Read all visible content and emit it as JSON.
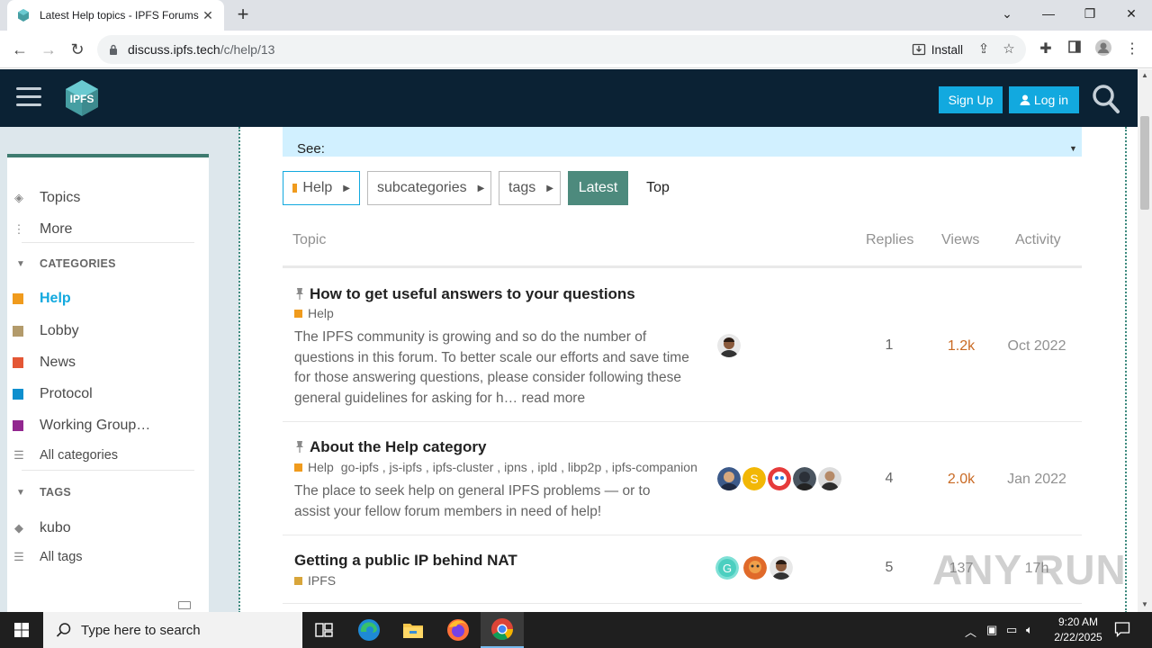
{
  "browser": {
    "tab_title": "Latest Help topics - IPFS Forums",
    "tab_close": "✕",
    "new_tab": "+",
    "url_host": "discuss.ipfs.tech",
    "url_path": "/c/help/13",
    "install_label": "Install",
    "controls": {
      "back": "←",
      "forward": "→",
      "reload": "↻"
    }
  },
  "window": {
    "minimize": "—",
    "maximize": "❐",
    "close": "✕",
    "tab_list": "⌄"
  },
  "header": {
    "logo_text": "IPFS",
    "signup_label": "Sign Up",
    "login_label": "Log in"
  },
  "sidebar": {
    "top_items": [
      {
        "label": "Topics",
        "icon": "layers-icon"
      },
      {
        "label": "More",
        "icon": "kebab-icon"
      }
    ],
    "categories_heading": "CATEGORIES",
    "categories": [
      {
        "label": "Help",
        "color": "#f09b1d",
        "active": true
      },
      {
        "label": "Lobby",
        "color": "#b39b6b"
      },
      {
        "label": "News",
        "color": "#e45735"
      },
      {
        "label": "Protocol",
        "color": "#0e8fce"
      },
      {
        "label": "Working Group…",
        "color": "#92278f"
      }
    ],
    "all_categories": "All categories",
    "tags_heading": "TAGS",
    "tags": [
      {
        "label": "kubo"
      }
    ],
    "all_tags": "All tags"
  },
  "banner": {
    "text": "See:"
  },
  "filters": {
    "category": "Help",
    "subcategories": "subcategories",
    "tags": "tags",
    "latest": "Latest",
    "top": "Top"
  },
  "table": {
    "headers": {
      "topic": "Topic",
      "replies": "Replies",
      "views": "Views",
      "activity": "Activity"
    },
    "rows": [
      {
        "title": "How to get useful answers to your questions",
        "pinned": true,
        "category": "Help",
        "category_color": "#f09b1d",
        "tags": "",
        "excerpt_lines": [
          "The IPFS community is growing and so do the number of",
          "questions in this forum. To better scale our efforts and save time",
          "for those answering questions, please consider following these",
          "general guidelines for asking for h… read more"
        ],
        "replies": "1",
        "views": "1.2k",
        "activity": "Oct 2022"
      },
      {
        "title": "About the Help category",
        "pinned": true,
        "category": "Help",
        "category_color": "#f09b1d",
        "tags": "go-ipfs , js-ipfs , ipfs-cluster , ipns , ipld , libp2p , ipfs-companion",
        "excerpt_lines": [
          "The place to seek help on general IPFS problems — or to",
          "assist your fellow forum members in need of help!"
        ],
        "replies": "4",
        "views": "2.0k",
        "activity": "Jan 2022"
      },
      {
        "title": "Getting a public IP behind NAT",
        "pinned": false,
        "category": "IPFS",
        "category_color": "#d8a53a",
        "tags": "",
        "excerpt_lines": [],
        "replies": "5",
        "views": "137",
        "activity": "17h"
      }
    ]
  },
  "watermark": "ANY RUN",
  "taskbar": {
    "search_placeholder": "Type here to search",
    "time": "9:20 AM",
    "date": "2/22/2025"
  }
}
